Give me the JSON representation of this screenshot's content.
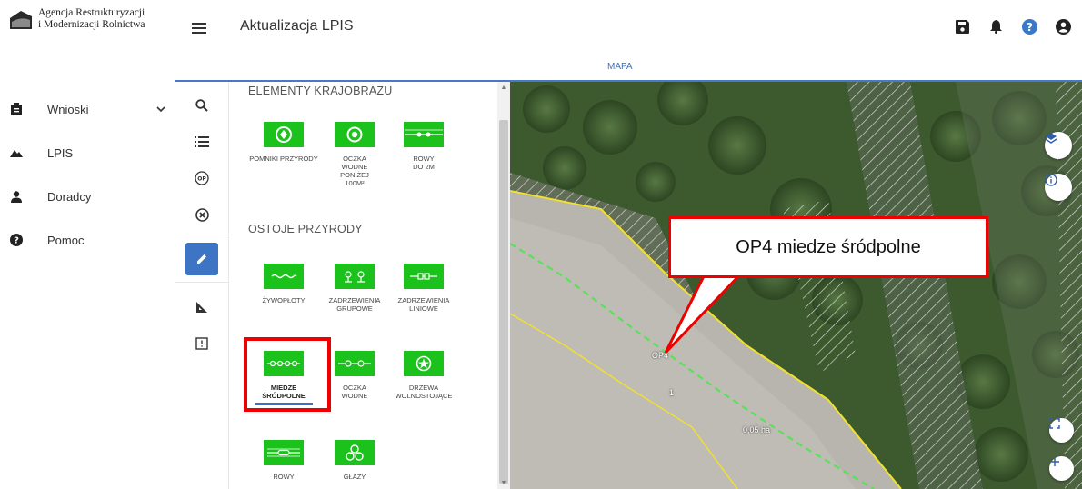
{
  "org": {
    "line1": "Agencja Restrukturyzacji",
    "line2": "i Modernizacji Rolnictwa",
    "logo_text": "ARiMR"
  },
  "header": {
    "title": "Aktualizacja LPIS",
    "icons": [
      "save-icon",
      "bell-icon",
      "help-icon",
      "account-icon"
    ]
  },
  "sidebar": {
    "items": [
      {
        "label": "Wnioski",
        "icon": "clipboard-icon",
        "has_chevron": true
      },
      {
        "label": "LPIS",
        "icon": "mountain-icon"
      },
      {
        "label": "Doradcy",
        "icon": "person-icon"
      },
      {
        "label": "Pomoc",
        "icon": "help-icon"
      }
    ]
  },
  "tabs": {
    "active": "MAPA"
  },
  "rail": {
    "tools": [
      "search-icon",
      "list-icon",
      "op-icon",
      "cancel-icon",
      "edit-icon",
      "measure-icon",
      "report-icon"
    ],
    "op_text": "OP"
  },
  "panel": {
    "section1": {
      "title": "ELEMENTY KRAJOBRAZU",
      "tiles": [
        {
          "label": "POMNIKI PRZYRODY",
          "icon": "monument-icon"
        },
        {
          "label": "OCZKA WODNE PONIŻEJ 100M²",
          "icon": "pond-icon"
        },
        {
          "label": "ROWY DO 2M",
          "icon": "ditch-icon"
        }
      ]
    },
    "section2": {
      "title": "OSTOJE PRZYRODY",
      "tiles": [
        {
          "label": "ŻYWOPŁOTY",
          "icon": "hedge-icon"
        },
        {
          "label": "ZADRZEWIENIA GRUPOWE",
          "icon": "tree-group-icon"
        },
        {
          "label": "ZADRZEWIENIA LINIOWE",
          "icon": "tree-line-icon"
        },
        {
          "label": "MIEDZE ŚRÓDPOLNE",
          "icon": "field-balk-icon",
          "selected": true
        },
        {
          "label": "OCZKA WODNE",
          "icon": "pond-icon"
        },
        {
          "label": "DRZEWA WOLNOSTOJĄCE",
          "icon": "tree-single-icon"
        },
        {
          "label": "ROWY",
          "icon": "ditch-icon"
        },
        {
          "label": "GŁAZY",
          "icon": "boulder-icon"
        }
      ]
    }
  },
  "map": {
    "callout": "OP4 miedze śródpolne",
    "feature_label": "OP4",
    "area_label": "0,05 ha",
    "parcel_number": "1",
    "buttons": [
      "layers-icon",
      "info-icon",
      "fullscreen-icon",
      "zoom-in-icon"
    ]
  },
  "colors": {
    "accent": "#3d74c3",
    "tile_green": "#1bc21b",
    "highlight_red": "#e00000",
    "parcel_yellow": "#f0e030"
  }
}
